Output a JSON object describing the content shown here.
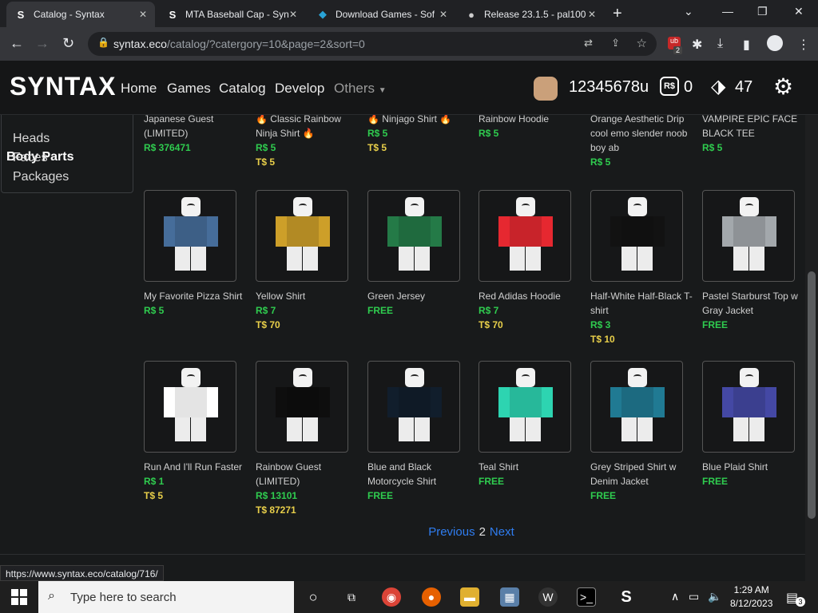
{
  "browser": {
    "tabs": [
      {
        "title": "Catalog - Syntax",
        "fav": "S",
        "active": true
      },
      {
        "title": "MTA Baseball Cap - Syn",
        "fav": "S",
        "active": false
      },
      {
        "title": "Download Games - Sof",
        "fav": "◆",
        "active": false
      },
      {
        "title": "Release 23.1.5 - pal100",
        "fav": "●",
        "active": false
      }
    ],
    "url_host": "syntax.eco",
    "url_rest": "/catalog/?catergory=10&page=2&sort=0",
    "status_url": "https://www.syntax.eco/catalog/716/",
    "ext_badge": "2"
  },
  "site": {
    "logo": "SYNTAX",
    "nav": [
      "Home",
      "Games",
      "Catalog",
      "Develop",
      "Others"
    ],
    "username": "12345678u",
    "robux_icon": "R$",
    "robux": "0",
    "tix": "47"
  },
  "sidebar": {
    "title": "Body Parts",
    "items": [
      "Heads",
      "Faces",
      "Packages"
    ]
  },
  "items_row0": [
    {
      "name": "Japanese Guest (LIMITED)",
      "robux": "R$ 376471",
      "tix": "",
      "free": ""
    },
    {
      "name": "🔥 Classic Rainbow Ninja Shirt 🔥",
      "robux": "R$ 5",
      "tix": "T$ 5",
      "free": ""
    },
    {
      "name": "🔥 Ninjago Shirt 🔥",
      "robux": "R$ 5",
      "tix": "T$ 5",
      "free": ""
    },
    {
      "name": "Rainbow Hoodie",
      "robux": "R$ 5",
      "tix": "",
      "free": ""
    },
    {
      "name": "Orange Aesthetic Drip cool emo slender noob boy ab",
      "robux": "R$ 5",
      "tix": "",
      "free": ""
    },
    {
      "name": "VAMPIRE EPIC FACE BLACK TEE",
      "robux": "R$ 5",
      "tix": "",
      "free": ""
    }
  ],
  "items_row1": [
    {
      "name": "My Favorite Pizza Shirt",
      "robux": "R$ 5",
      "tix": "",
      "free": "",
      "color": "#3d5f86"
    },
    {
      "name": "Yellow Shirt",
      "robux": "R$ 7",
      "tix": "T$ 70",
      "free": "",
      "color": "#b28a24"
    },
    {
      "name": "Green Jersey",
      "robux": "",
      "tix": "",
      "free": "FREE",
      "color": "#1f6a3e"
    },
    {
      "name": "Red Adidas Hoodie",
      "robux": "R$ 7",
      "tix": "T$ 70",
      "free": "",
      "color": "#c8232a"
    },
    {
      "name": "Half-White Half-Black T-shirt",
      "robux": "R$ 3",
      "tix": "T$ 10",
      "free": "",
      "color": "#101010"
    },
    {
      "name": "Pastel Starburst Top w Gray Jacket",
      "robux": "",
      "tix": "",
      "free": "FREE",
      "color": "#8e9296"
    }
  ],
  "items_row2": [
    {
      "name": "Run And I'll Run Faster",
      "robux": "R$ 1",
      "tix": "T$ 5",
      "free": "",
      "color": "#e4e4e4"
    },
    {
      "name": "Rainbow Guest (LIMITED)",
      "robux": "R$ 13101",
      "tix": "T$ 87271",
      "free": "",
      "color": "#0c0c0c"
    },
    {
      "name": "Blue and Black Motorcycle Shirt",
      "robux": "",
      "tix": "",
      "free": "FREE",
      "color": "#0f1a26"
    },
    {
      "name": "Teal Shirt",
      "robux": "",
      "tix": "",
      "free": "FREE",
      "color": "#27b89a"
    },
    {
      "name": "Grey Striped Shirt w Denim Jacket",
      "robux": "",
      "tix": "",
      "free": "FREE",
      "color": "#1c6a80"
    },
    {
      "name": "Blue Plaid Shirt",
      "robux": "",
      "tix": "",
      "free": "FREE",
      "color": "#3b3f8f"
    }
  ],
  "pager": {
    "prev": "Previous",
    "page": "2",
    "next": "Next"
  },
  "taskbar": {
    "search_placeholder": "Type here to search",
    "time": "1:29 AM",
    "date": "8/12/2023",
    "notif": "3"
  },
  "colors": {
    "robux_green": "#2fcc4f",
    "tix_yellow": "#e8cf4a",
    "link_blue": "#2f7df0"
  }
}
